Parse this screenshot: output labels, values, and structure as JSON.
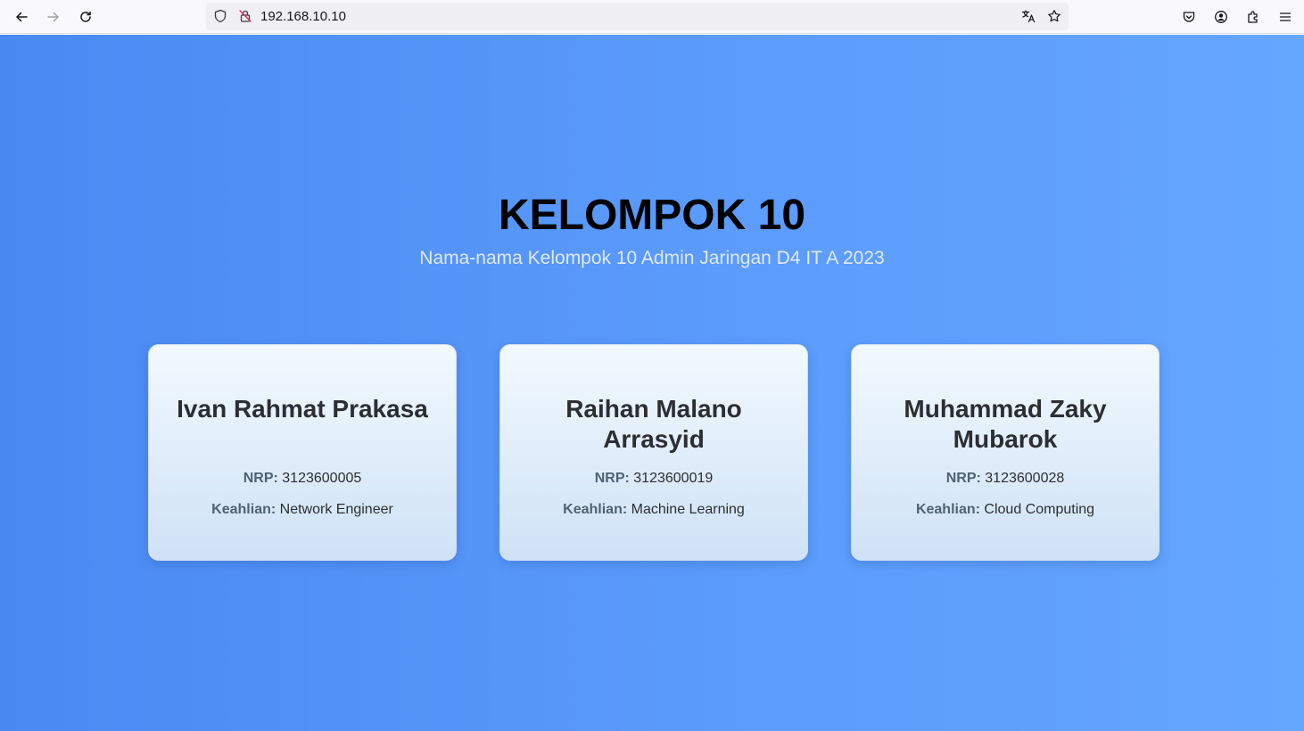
{
  "browser": {
    "url": "192.168.10.10"
  },
  "page": {
    "title": "KELOMPOK 10",
    "subtitle": "Nama-nama Kelompok 10 Admin Jaringan D4 IT A 2023",
    "nrp_label": "NRP:",
    "keahlian_label": "Keahlian:",
    "members": [
      {
        "name": "Ivan Rahmat Prakasa",
        "nrp": "3123600005",
        "keahlian": "Network Engineer"
      },
      {
        "name": "Raihan Malano Arrasyid",
        "nrp": "3123600019",
        "keahlian": "Machine Learning"
      },
      {
        "name": "Muhammad Zaky Mubarok",
        "nrp": "3123600028",
        "keahlian": "Cloud Computing"
      }
    ]
  },
  "colors": {
    "background_start": "#4a89f2",
    "background_end": "#65a6ff",
    "title": "#000000",
    "subtitle": "#dfeaff",
    "card_label": "#4f6273"
  }
}
